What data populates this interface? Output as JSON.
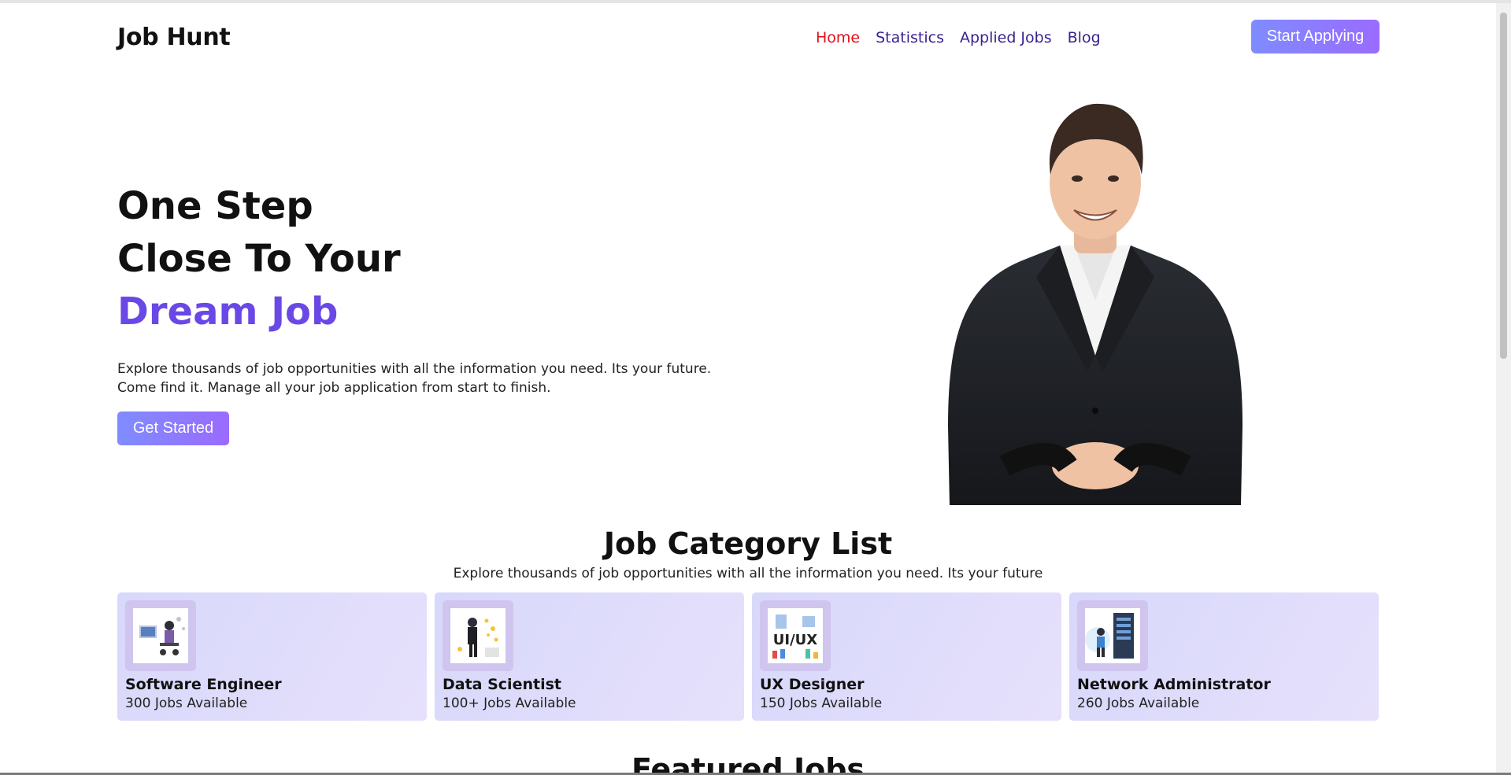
{
  "header": {
    "logo": "Job Hunt",
    "nav": [
      {
        "label": "Home",
        "active": true
      },
      {
        "label": "Statistics",
        "active": false
      },
      {
        "label": "Applied Jobs",
        "active": false
      },
      {
        "label": "Blog",
        "active": false
      }
    ],
    "cta_label": "Start Applying"
  },
  "hero": {
    "title_line1": "One Step",
    "title_line2": "Close To Your",
    "title_accent": "Dream Job",
    "description": "Explore thousands of job opportunities with all the information you need. Its your future. Come find it. Manage all your job application from start to finish.",
    "button_label": "Get Started",
    "image": "smiling-man-in-suit"
  },
  "categories": {
    "title": "Job Category List",
    "subtitle": "Explore thousands of job opportunities with all the information you need. Its your future",
    "items": [
      {
        "name": "Software Engineer",
        "count": "300 Jobs Available",
        "icon": "developer-at-desk-illustration"
      },
      {
        "name": "Data Scientist",
        "count": "100+ Jobs Available",
        "icon": "data-scientist-illustration"
      },
      {
        "name": "UX Designer",
        "count": "150 Jobs Available",
        "icon": "ui-ux-illustration"
      },
      {
        "name": "Network Administrator",
        "count": "260 Jobs Available",
        "icon": "server-rack-illustration"
      }
    ]
  },
  "featured": {
    "title": "Featured Jobs"
  },
  "colors": {
    "accent": "#6a48e6",
    "nav_active": "#e0101a",
    "nav_link": "#3b1f8f",
    "button_gradient_start": "#7f8cff",
    "button_gradient_end": "#9a6bff",
    "card_bg": "#dcdafb"
  }
}
